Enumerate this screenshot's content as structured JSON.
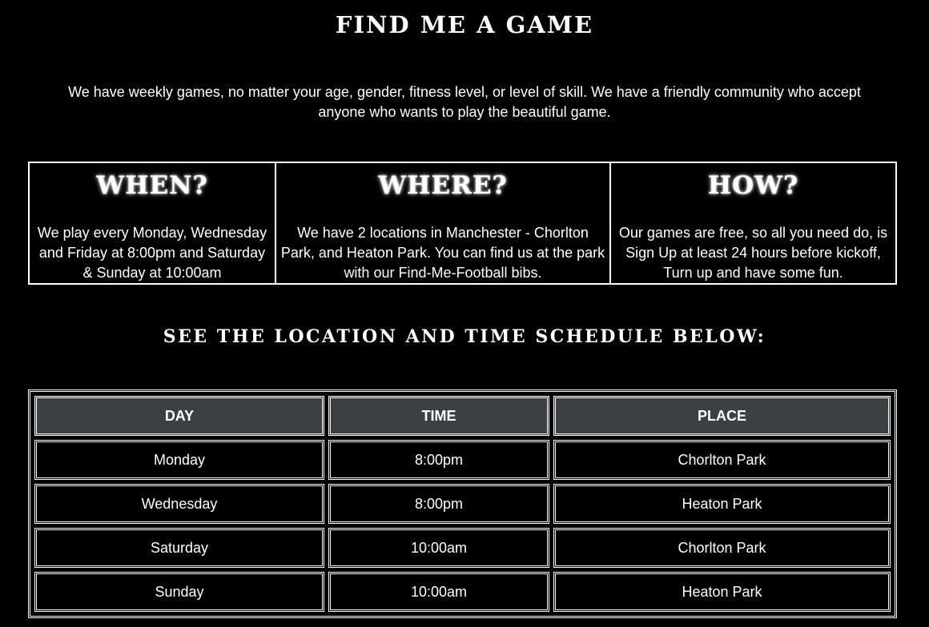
{
  "page_title": "FIND ME A GAME",
  "intro": "We have weekly games, no matter your age, gender, fitness level, or level of skill. We have a friendly community who accept anyone who wants to play the beautiful game.",
  "info": [
    {
      "heading": "WHEN?",
      "text": "We play every Monday, Wednesday and Friday at 8:00pm and Saturday & Sunday at 10:00am"
    },
    {
      "heading": "WHERE?",
      "text": "We have 2 locations in Manchester - Chorlton Park, and Heaton Park. You can find us at the park with our Find-Me-Football bibs."
    },
    {
      "heading": "HOW?",
      "text": "Our games are free, so all you need do, is Sign Up at least 24 hours before kickoff, Turn up and have some fun."
    }
  ],
  "schedule_heading": "SEE THE LOCATION AND TIME SCHEDULE BELOW:",
  "schedule": {
    "headers": [
      "DAY",
      "TIME",
      "PLACE"
    ],
    "rows": [
      [
        "Monday",
        "8:00pm",
        "Chorlton Park"
      ],
      [
        "Wednesday",
        "8:00pm",
        "Heaton Park"
      ],
      [
        "Saturday",
        "10:00am",
        "Chorlton Park"
      ],
      [
        "Sunday",
        "10:00am",
        "Heaton Park"
      ]
    ]
  },
  "colors": {
    "background": "#000000",
    "text": "#ffffff",
    "table_header_bg": "#3d4043"
  }
}
